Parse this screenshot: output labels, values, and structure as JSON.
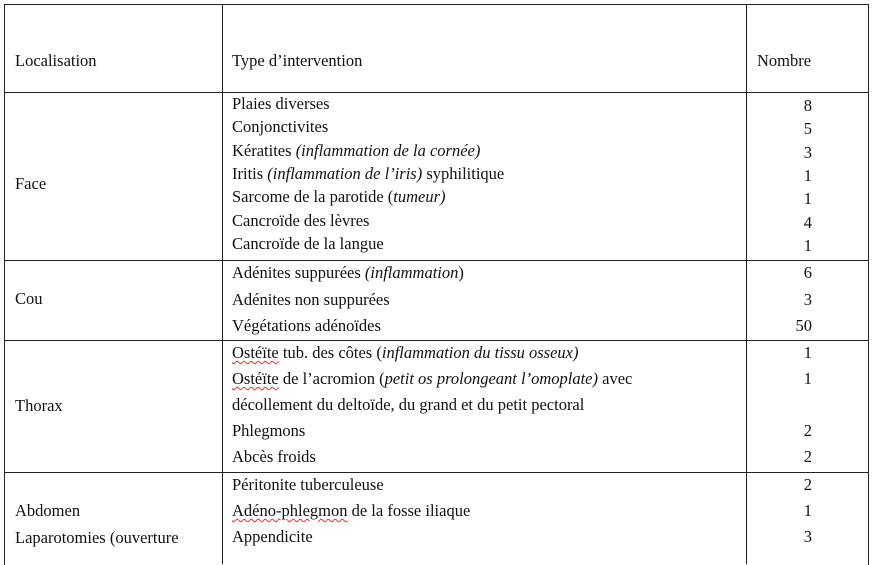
{
  "header": {
    "localisation": "Localisation",
    "type": "Type d’intervention",
    "nombre": "Nombre"
  },
  "sections": [
    {
      "label": [
        "Face"
      ],
      "items": [
        {
          "parts": [
            [
              "Plaies diverses",
              ""
            ]
          ],
          "count": "8"
        },
        {
          "parts": [
            [
              "Conjonctivites",
              ""
            ]
          ],
          "count": "5"
        },
        {
          "parts": [
            [
              "Kératites ",
              ""
            ],
            [
              "(inflammation de la cornée)",
              "i"
            ]
          ],
          "count": "3"
        },
        {
          "parts": [
            [
              "Iritis ",
              ""
            ],
            [
              "(inflammation de l’iris)",
              "i"
            ],
            [
              " syphilitique",
              ""
            ]
          ],
          "count": "1"
        },
        {
          "parts": [
            [
              "Sarcome de la parotide (",
              ""
            ],
            [
              "tumeur)",
              "i"
            ]
          ],
          "count": "1"
        },
        {
          "parts": [
            [
              "Cancroïde des lèvres",
              ""
            ]
          ],
          "count": "4"
        },
        {
          "parts": [
            [
              "Cancroïde de la langue",
              ""
            ]
          ],
          "count": "1"
        }
      ]
    },
    {
      "label": [
        "Cou"
      ],
      "items": [
        {
          "parts": [
            [
              "Adénites suppurées ",
              ""
            ],
            [
              "(inflammation",
              "i"
            ],
            [
              ")",
              ""
            ]
          ],
          "count": "6"
        },
        {
          "parts": [
            [
              "Adénites non suppurées",
              ""
            ]
          ],
          "count": "3"
        },
        {
          "parts": [
            [
              "Végétations adénoïdes",
              ""
            ]
          ],
          "count": "50"
        }
      ]
    },
    {
      "label": [
        "Thorax"
      ],
      "items": [
        {
          "parts": [
            [
              "Ostéïte",
              "s"
            ],
            [
              " tub. des côtes (",
              ""
            ],
            [
              "inflammation du tissu osseux)",
              "i"
            ]
          ],
          "count": "1"
        },
        {
          "parts": [
            [
              "Ostéïte",
              "s"
            ],
            [
              " de l’acromion (",
              ""
            ],
            [
              "petit os prolongeant l’omoplate)",
              "i"
            ],
            [
              " avec",
              ""
            ]
          ],
          "count": "1"
        },
        {
          "parts": [
            [
              "décollement du deltoïde, du grand et du petit pectoral",
              ""
            ]
          ],
          "count": ""
        },
        {
          "parts": [
            [
              "Phlegmons",
              ""
            ]
          ],
          "count": "2"
        },
        {
          "parts": [
            [
              "Abcès froids",
              ""
            ]
          ],
          "count": "2"
        }
      ]
    },
    {
      "label": [
        "Abdomen",
        "Laparotomies (ouverture"
      ],
      "items": [
        {
          "parts": [
            [
              "Péritonite tuberculeuse",
              ""
            ]
          ],
          "count": "2"
        },
        {
          "parts": [
            [
              "Adéno-phlegmon",
              "s"
            ],
            [
              " de la fosse iliaque",
              ""
            ]
          ],
          "count": "1"
        },
        {
          "parts": [
            [
              "Appendicite",
              ""
            ]
          ],
          "count": "3"
        }
      ]
    }
  ]
}
